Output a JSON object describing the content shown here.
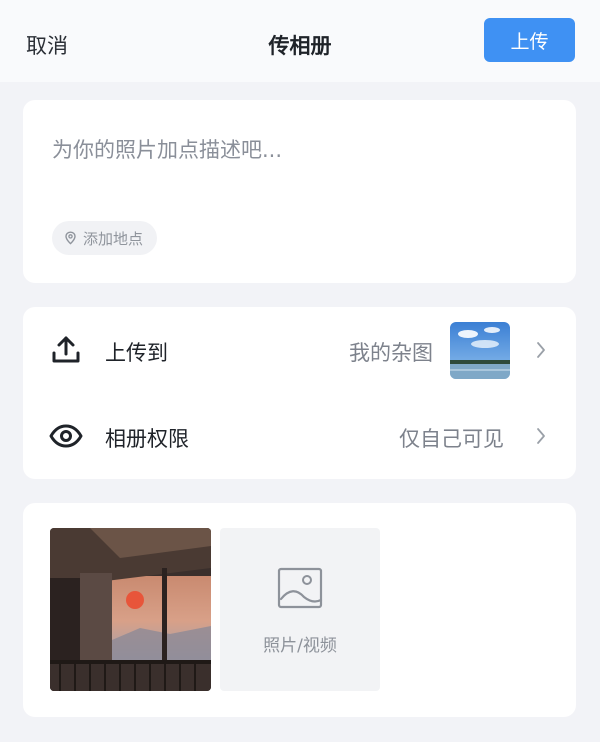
{
  "header": {
    "cancel_label": "取消",
    "title": "传相册",
    "upload_label": "上传"
  },
  "description": {
    "placeholder": "为你的照片加点描述吧...",
    "location_chip": "添加地点"
  },
  "settings": {
    "upload_to": {
      "label": "上传到",
      "value": "我的杂图"
    },
    "permission": {
      "label": "相册权限",
      "value": "仅自己可见"
    }
  },
  "media": {
    "add_label": "照片/视频"
  },
  "colors": {
    "accent": "#3f91f3",
    "background": "#f2f3f7",
    "card": "#ffffff",
    "muted_text": "#8a8f99"
  },
  "icons": [
    "location-pin-icon",
    "upload-icon",
    "eye-icon",
    "chevron-right-icon",
    "image-add-icon"
  ]
}
